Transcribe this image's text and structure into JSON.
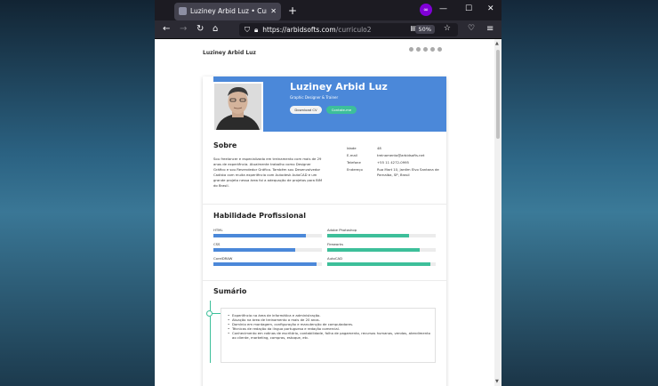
{
  "browser": {
    "tab_title": "Luziney Arbid Luz • Currículo",
    "tab_close": "✕",
    "new_tab": "+",
    "ext_icon": "∞",
    "min": "—",
    "max": "☐",
    "close": "✕",
    "url_domain": "https://arbidsofts.com",
    "url_path": "/curriculo2",
    "zoom": "50%",
    "icons": {
      "back": "back-arrow-icon",
      "forward": "forward-arrow-icon",
      "reload": "reload-icon",
      "home": "home-icon",
      "shield": "shield-icon",
      "lock": "lock-icon",
      "reader": "reader-view-icon",
      "bookmark": "star-icon",
      "pocket": "pocket-icon",
      "menu": "hamburger-menu-icon"
    }
  },
  "page": {
    "header_name": "Luziney Arbid Luz",
    "hero": {
      "name": "Luziney Arbid Luz",
      "role": "Graphic Designer & Trainer",
      "download_cv": "Download CV",
      "contact": "Contate-me"
    },
    "about": {
      "title": "Sobre",
      "text": "Sou freelancer e especializado em treinamento com mais de 29 anos de experiência. Atualmente trabalho como Designer Gráfico e sou Revendedor Gráfico. Também sou Desenvolvedor Cadista com muita experiência com Autodesk AutoCAD e um grande projeto nessa área foi a adequação de projetos para BIM do Brasil.",
      "info": [
        {
          "label": "Idade",
          "value": "48"
        },
        {
          "label": "E-mail",
          "value": "treinamento@arbidsofts.net"
        },
        {
          "label": "Telefone",
          "value": "+55 11 4272-0995"
        },
        {
          "label": "Endereço",
          "value": "Rua Mart 10, Jardim Elvo Santana de Parnaíba, SP, Brasil"
        }
      ]
    },
    "skills": {
      "title": "Habilidade Profissional",
      "items": [
        {
          "name": "HTML",
          "value": 85,
          "color": "#4b88d9"
        },
        {
          "name": "Adobe Photoshop",
          "value": 75,
          "color": "#3dbf9a"
        },
        {
          "name": "CSS",
          "value": 75,
          "color": "#4b88d9"
        },
        {
          "name": "Fireworks",
          "value": 85,
          "color": "#3dbf9a"
        },
        {
          "name": "CorelDRAW",
          "value": 95,
          "color": "#4b88d9"
        },
        {
          "name": "AutoCAD",
          "value": 95,
          "color": "#3dbf9a"
        }
      ]
    },
    "summary": {
      "title": "Sumário",
      "items": [
        "Experiência na área de informática e administração.",
        "Atuação na área de treinamento a mais de 20 anos.",
        "Domínio em montagem, configuração e manutenção de computadores.",
        "Técnicas de redação da língua portuguesa e redação comercial.",
        "Conhecimento em rotinas de escritório, contabilidade, folha de pagamento, recursos humanos, vendas, atendimento ao cliente, marketing, compras, estoque, etc."
      ]
    }
  }
}
